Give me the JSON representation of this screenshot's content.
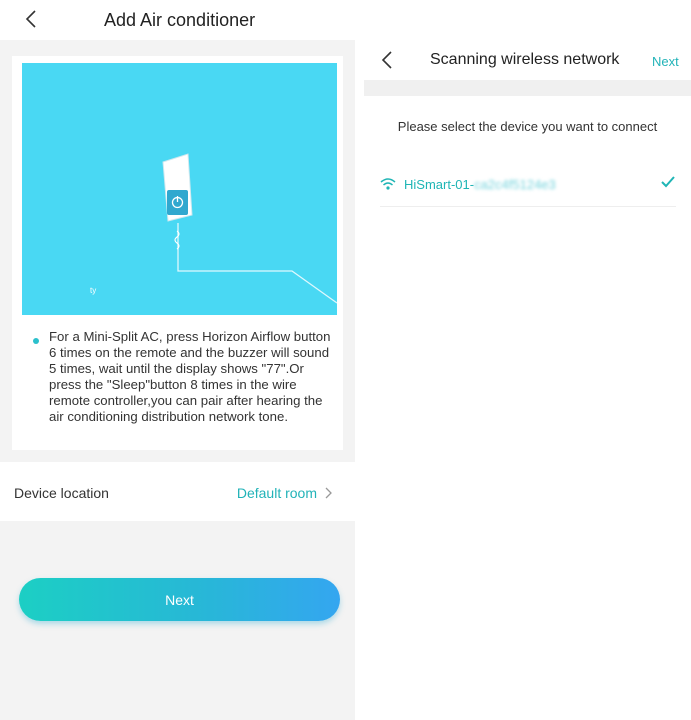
{
  "left_screen": {
    "title": "Add Air conditioner",
    "illustration": {
      "panel_color": "#49d8f3",
      "device_label": "ty",
      "icons": [
        "power-icon"
      ]
    },
    "instruction": "For a Mini-Split AC, press Horizon Airflow button 6 times on the remote and the buzzer will sound 5 times, wait until the display shows \"77\".Or press the \"Sleep\"button 8 times in the wire remote controller,you can pair after hearing the air conditioning distribution network tone.",
    "location_label": "Device location",
    "location_value": "Default room",
    "next_button": "Next"
  },
  "right_screen": {
    "title": "Scanning wireless network",
    "next_link": "Next",
    "prompt": "Please select the device you want to connect",
    "networks": [
      {
        "name_prefix": "HiSmart-01-",
        "name_suffix": "ca2c4f5124e3",
        "selected": true
      }
    ]
  },
  "colors": {
    "accent": "#22b3b8",
    "button_gradient_start": "#1ccfc4",
    "button_gradient_end": "#34a6f0",
    "background": "#f3f3f3"
  }
}
